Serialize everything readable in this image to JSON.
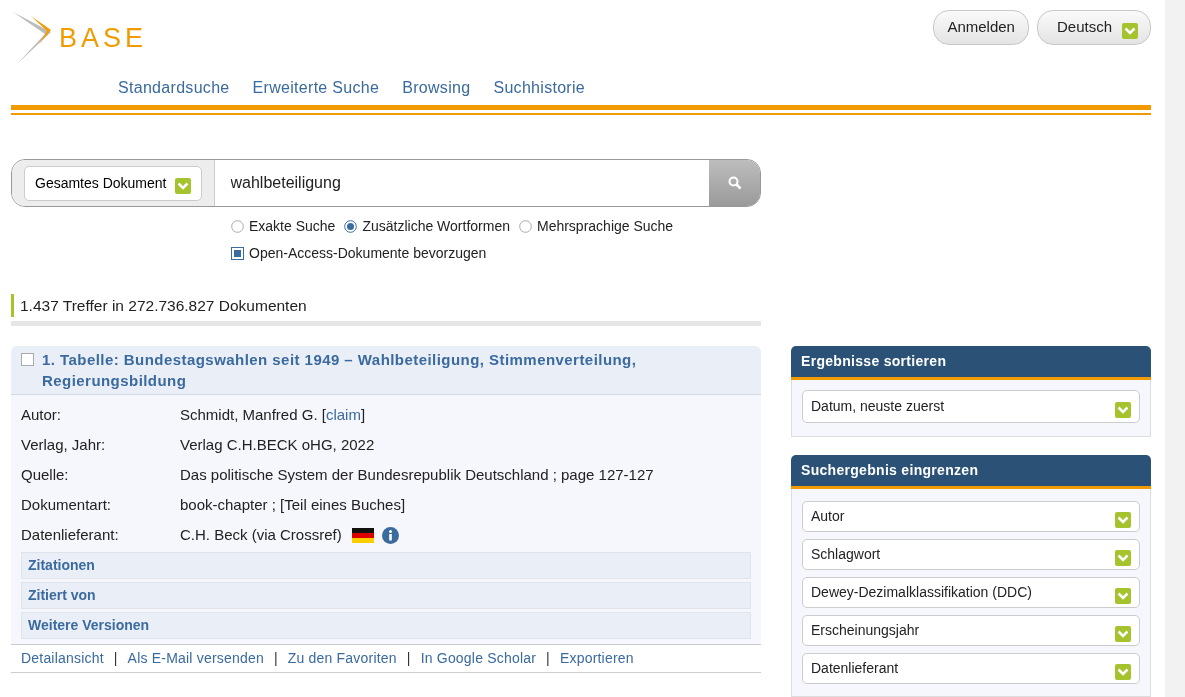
{
  "logo": {
    "text": "BASE"
  },
  "header_buttons": [
    {
      "label": "Anmelden",
      "kind": "plain"
    },
    {
      "label": "Deutsch",
      "kind": "dropdown"
    }
  ],
  "nav": [
    "Standardsuche",
    "Erweiterte Suche",
    "Browsing",
    "Suchhistorie"
  ],
  "search": {
    "scope": "Gesamtes Dokument",
    "value": "wahlbeteiligung",
    "modes": [
      {
        "label": "Exakte Suche",
        "selected": false
      },
      {
        "label": "Zusätzliche Wortformen",
        "selected": true
      },
      {
        "label": "Mehrsprachige Suche",
        "selected": false
      }
    ],
    "open_access": {
      "label": "Open-Access-Dokumente bevorzugen",
      "checked": true
    }
  },
  "hits": "1.437 Treffer in 272.736.827 Dokumenten",
  "result": {
    "checked": false,
    "title": "1. Tabelle: Bundestagswahlen seit 1949 – Wahlbeteiligung, Stimmenverteilung, Regierungsbildung",
    "fields": [
      {
        "label": "Autor:",
        "value": "Schmidt, Manfred G. [",
        "link": "claim",
        "after": "]"
      },
      {
        "label": "Verlag, Jahr:",
        "value": "Verlag C.H.BECK oHG, 2022"
      },
      {
        "label": "Quelle:",
        "value": "Das politische System der Bundesrepublik Deutschland ; page 127-127"
      },
      {
        "label": "Dokumentart:",
        "value": "book-chapter ; [Teil eines Buches]"
      },
      {
        "label": "Datenlieferant:",
        "value": "C.H. Beck (via Crossref)",
        "flag": true,
        "info": true
      }
    ],
    "sections": [
      "Zitationen",
      "Zitiert von",
      "Weitere Versionen"
    ],
    "actions": [
      "Detailansicht",
      "Als E-Mail versenden",
      "Zu den Favoriten",
      "In Google Scholar",
      "Exportieren"
    ],
    "separators": [
      "|",
      "|",
      "|",
      "|"
    ]
  },
  "sort_panel": {
    "title": "Ergebnisse sortieren",
    "value": "Datum, neuste zuerst"
  },
  "filter_panel": {
    "title": "Suchergebnis eingrenzen",
    "facets": [
      "Autor",
      "Schlagwort",
      "Dewey-Dezimalklassifikation (DDC)",
      "Erscheinungsjahr",
      "Datenlieferant"
    ]
  }
}
